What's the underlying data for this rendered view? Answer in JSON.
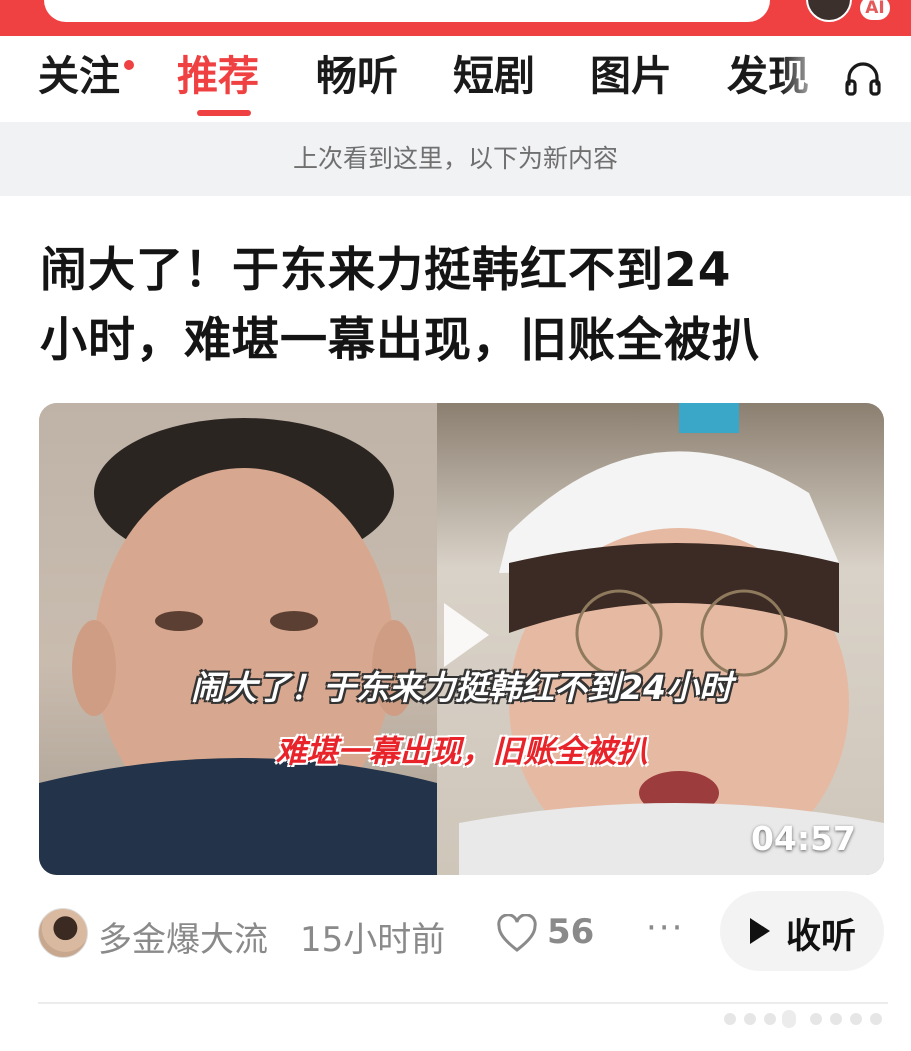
{
  "tabs": [
    {
      "label": "关注",
      "has_dot": true
    },
    {
      "label": "推荐",
      "active": true
    },
    {
      "label": "畅听"
    },
    {
      "label": "短剧"
    },
    {
      "label": "图片"
    },
    {
      "label": "发现"
    }
  ],
  "top": {
    "ai_badge": "AI"
  },
  "notice": "上次看到这里，以下为新内容",
  "article": {
    "title_line1": "闹大了！于东来力挺韩红不到24",
    "title_line2": "小时，难堪一幕出现，旧账全被扒",
    "video_caption_line1": "闹大了！于东来力挺韩红不到24小时",
    "video_caption_line2": "难堪一幕出现，旧账全被扒",
    "duration": "04:57",
    "author": "多金爆大流",
    "time": "15小时前",
    "likes": "56",
    "more": "···",
    "listen_label": "收听"
  },
  "icons": {
    "headphone": "headphone-icon",
    "like": "heart-icon",
    "play": "play-icon",
    "more": "more-icon"
  },
  "colors": {
    "accent": "#f04142",
    "notice_bg": "#f1f2f4",
    "meta_text": "#8a8a8a"
  }
}
